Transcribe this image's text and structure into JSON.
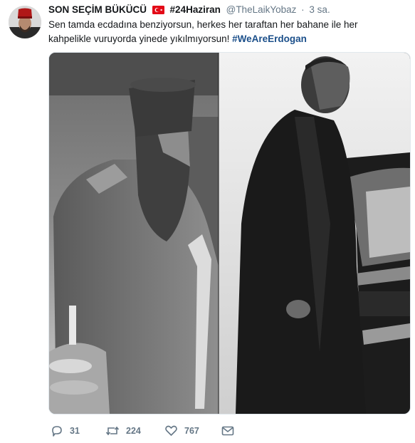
{
  "tweet": {
    "display_name": "SON SEÇİM BÜKÜCÜ",
    "flag_icon": "turkey-flag-icon",
    "header_hashtag": "#24Haziran",
    "handle": "@TheLaikYobaz",
    "separator": "·",
    "time": "3 sa.",
    "text_line1": "Sen tamda ecdadına benziyorsun, herkes her taraftan her bahane ile her",
    "text_line2_prefix": "kahpelikle vuruyorda yinede yıkılmıyorsun! ",
    "text_hashtag": "#WeAreErdogan"
  },
  "actions": {
    "reply_count": "31",
    "retweet_count": "224",
    "like_count": "767"
  },
  "colors": {
    "link": "#1b4f8a",
    "muted": "#657786",
    "text": "#14171a"
  }
}
